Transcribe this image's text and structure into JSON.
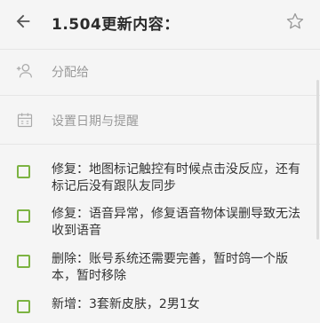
{
  "header": {
    "back_icon": "arrow-left-icon",
    "title": "1.504更新内容：",
    "star_icon": "star-outline-icon"
  },
  "meta": {
    "assign": {
      "icon": "person-add-icon",
      "label": "分配给"
    },
    "due": {
      "icon": "calendar-icon",
      "label": "设置日期与提醒"
    }
  },
  "todos": [
    {
      "text": "修复：地图标记触控有时候点击没反应，还有标记后没有跟队友同步",
      "checked": false
    },
    {
      "text": "修复：语音异常，修复语音物体误删导致无法收到语音",
      "checked": false
    },
    {
      "text": "删除：账号系统还需要完善，暂时鸽一个版本，暂时移除",
      "checked": false
    },
    {
      "text": "新增：3套新皮肤，2男1女",
      "checked": false
    }
  ],
  "colors": {
    "checkbox_border": "#7cb342",
    "muted_text": "#9a9a9a",
    "background": "#f5f5f5"
  }
}
